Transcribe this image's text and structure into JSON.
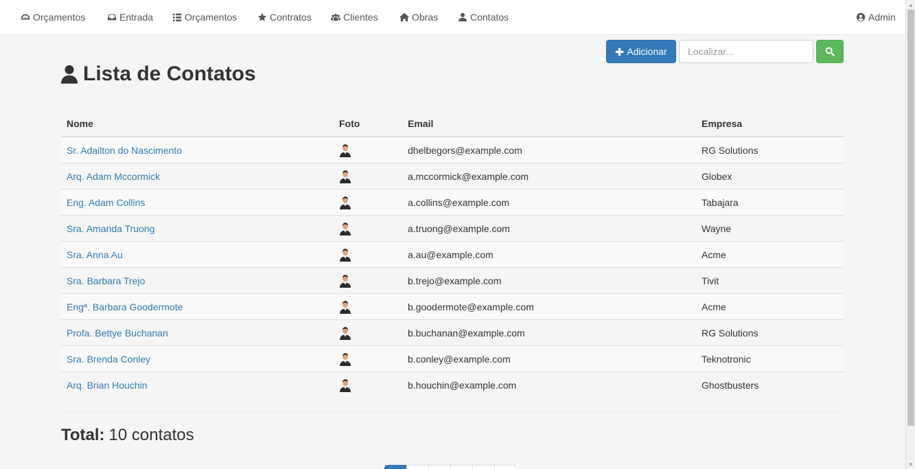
{
  "navbar": {
    "items": [
      {
        "label": "Orçamentos",
        "icon": "dashboard-icon"
      },
      {
        "label": "Entrada",
        "icon": "inbox-icon"
      },
      {
        "label": "Orçamentos",
        "icon": "list-icon"
      },
      {
        "label": "Contratos",
        "icon": "star-icon"
      },
      {
        "label": "Clientes",
        "icon": "users-icon"
      },
      {
        "label": "Obras",
        "icon": "home-icon"
      },
      {
        "label": "Contatos",
        "icon": "user-icon"
      }
    ],
    "user": {
      "label": "Admin",
      "icon": "user-circle-icon"
    }
  },
  "toolbar": {
    "add_label": "Adicionar",
    "search_placeholder": "Localizar...",
    "accent_color": "#337ab7",
    "search_button_color": "#5cb85c"
  },
  "page": {
    "title": "Lista de Contatos"
  },
  "table": {
    "headers": {
      "nome": "Nome",
      "foto": "Foto",
      "email": "Email",
      "empresa": "Empresa"
    },
    "rows": [
      {
        "nome": "Sr. Adailton do Nascimento",
        "email": "dhelbegors@example.com",
        "empresa": "RG Solutions"
      },
      {
        "nome": "Arq. Adam Mccormick",
        "email": "a.mccormick@example.com",
        "empresa": "Globex"
      },
      {
        "nome": "Eng. Adam Collins",
        "email": "a.collins@example.com",
        "empresa": "Tabajara"
      },
      {
        "nome": "Sra. Amanda Truong",
        "email": "a.truong@example.com",
        "empresa": "Wayne"
      },
      {
        "nome": "Sra. Anna Au",
        "email": "a.au@example.com",
        "empresa": "Acme"
      },
      {
        "nome": "Sra. Barbara Trejo",
        "email": "b.trejo@example.com",
        "empresa": "Tivit"
      },
      {
        "nome": "Engª. Barbara Goodermote",
        "email": "b.goodermote@example.com",
        "empresa": "Acme"
      },
      {
        "nome": "Profa. Bettye Buchanan",
        "email": "b.buchanan@example.com",
        "empresa": "RG Solutions"
      },
      {
        "nome": "Sra. Brenda Conley",
        "email": "b.conley@example.com",
        "empresa": "Teknotronic"
      },
      {
        "nome": "Arq. Brian Houchin",
        "email": "b.houchin@example.com",
        "empresa": "Ghostbusters"
      }
    ]
  },
  "total": {
    "label": "Total:",
    "value": "10 contatos"
  },
  "pagination": {
    "pages": [
      "",
      "",
      "",
      "",
      "",
      ""
    ],
    "active_index": 0
  }
}
